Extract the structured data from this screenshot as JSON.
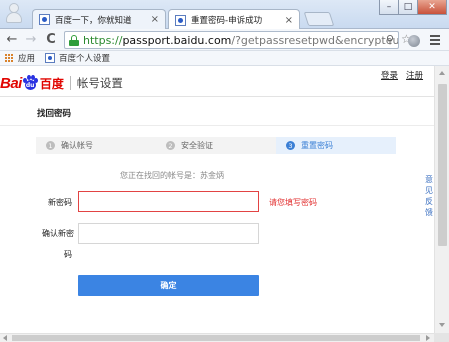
{
  "browser": {
    "tabs": [
      {
        "title": "百度一下，你就知道",
        "close": "×",
        "active": false
      },
      {
        "title": "重置密码-申诉成功",
        "close": "×",
        "active": true
      }
    ],
    "window_buttons": {
      "minimize": "–",
      "maximize": "□",
      "close": "✕"
    },
    "nav": {
      "back": "←",
      "forward": "→",
      "reload": "C"
    },
    "url": {
      "scheme": "https://",
      "host": "passport.baidu.com",
      "path": "/?getpassresetpwd&encrypteui("
    },
    "bookmarks": [
      {
        "label": "应用"
      },
      {
        "label": "百度个人设置"
      }
    ]
  },
  "page": {
    "logo": {
      "bai": "Bai",
      "du": "du",
      "cn": "百度"
    },
    "section_title": "帐号设置",
    "top_links": {
      "login": "登录",
      "register": "注册"
    },
    "subtitle": "找回密码",
    "steps": [
      {
        "num": "1",
        "label": "确认帐号",
        "active": false
      },
      {
        "num": "2",
        "label": "安全验证",
        "active": false
      },
      {
        "num": "3",
        "label": "重置密码",
        "active": true
      }
    ],
    "hint": "您正在找回的帐号是：苏金炳",
    "form": {
      "new_password_label": "新密码",
      "new_password_value": "",
      "new_password_error": "请您填写密码",
      "confirm_label_line1": "确认新密",
      "confirm_label_line2": "码",
      "confirm_value": "",
      "submit_label": "确定"
    },
    "feedback": [
      "意",
      "见",
      "反",
      "馈"
    ]
  },
  "colors": {
    "accent": "#3b84e3",
    "error": "#e22f2f",
    "step_active": "#3a7fd5",
    "baidu_red": "#e10602",
    "baidu_blue": "#2932e1"
  }
}
